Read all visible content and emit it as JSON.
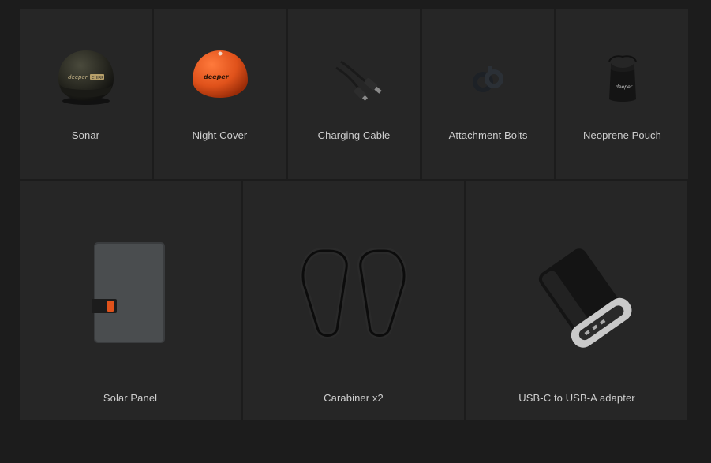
{
  "items_top": [
    {
      "label": "Sonar",
      "icon": "sonar-device-icon"
    },
    {
      "label": "Night Cover",
      "icon": "night-cover-icon"
    },
    {
      "label": "Charging Cable",
      "icon": "charging-cable-icon"
    },
    {
      "label": "Attachment Bolts",
      "icon": "attachment-bolts-icon"
    },
    {
      "label": "Neoprene Pouch",
      "icon": "neoprene-pouch-icon"
    }
  ],
  "items_bottom": [
    {
      "label": "Solar Panel",
      "icon": "solar-panel-icon"
    },
    {
      "label": "Carabiner x2",
      "icon": "carabiner-icon"
    },
    {
      "label": "USB-C to USB-A adapter",
      "icon": "usb-adapter-icon"
    }
  ],
  "logo_text": {
    "sonar": "deeper",
    "sonar_badge": "CHIRP",
    "night_cover": "deeper",
    "pouch": "deeper"
  },
  "colors": {
    "background": "#1c1c1c",
    "tile": "#262626",
    "label": "#cfcfcf",
    "accent_orange": "#e0521b"
  }
}
